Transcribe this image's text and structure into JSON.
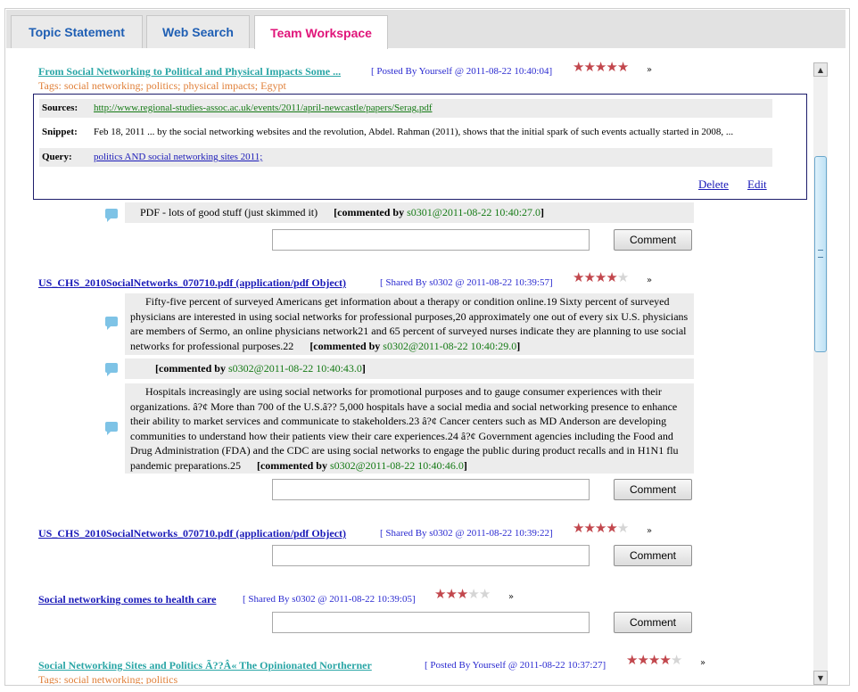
{
  "tabs": [
    {
      "label": "Topic Statement"
    },
    {
      "label": "Web Search"
    },
    {
      "label": "Team Workspace"
    }
  ],
  "items": [
    {
      "title": "From Social Networking to Political and Physical Impacts Some ...",
      "meta": "[ Posted By Yourself @ 2011-08-22 10:40:04]",
      "rating": 5,
      "tags": "Tags: social networking; politics; physical impacts; Egypt",
      "details": {
        "sources_label": "Sources:",
        "sources_value": "http://www.regional-studies-assoc.ac.uk/events/2011/april-newcastle/papers/Serag.pdf",
        "snippet_label": "Snippet:",
        "snippet_value": "Feb 18, 2011 ... by the social networking websites and the revolution, Abdel. Rahman (2011), shows that the initial spark of such events actually started in 2008, ...",
        "query_label": "Query:",
        "query_value": "politics AND social networking sites 2011;",
        "delete_label": "Delete",
        "edit_label": "Edit"
      },
      "comments": [
        {
          "text": "PDF - lots of good stuff (just skimmed it)",
          "by": "[commented by",
          "user": "s0301@2011-08-22 10:40:27.0",
          "end": "]"
        }
      ]
    },
    {
      "title": "US_CHS_2010SocialNetworks_070710.pdf (application/pdf Object)",
      "meta": "[ Shared By s0302 @ 2011-08-22 10:39:57]",
      "rating": 4,
      "comments": [
        {
          "text": "Fifty-five percent of surveyed Americans get information about a therapy or condition online.19 Sixty percent of surveyed physicians are interested in using social networks for professional purposes,20 approximately one out of every six U.S. physicians are members of Sermo, an online physicians network21 and 65 percent of surveyed nurses indicate they are planning to use social networks for professional purposes.22",
          "by": "[commented by",
          "user": "s0302@2011-08-22 10:40:29.0",
          "end": "]"
        },
        {
          "text": "",
          "by": "[commented by",
          "user": "s0302@2011-08-22 10:40:43.0",
          "end": "]"
        },
        {
          "text": "Hospitals increasingly are using social networks for promotional purposes and to gauge consumer experiences with their organizations. â?¢ More than 700 of the U.S.â?? 5,000 hospitals have a social media and social networking presence to enhance their ability to market services and communicate to stakeholders.23 â?¢ Cancer centers such as MD Anderson are developing communities to understand how their patients view their care experiences.24 â?¢ Government agencies including the Food and Drug Administration (FDA) and the CDC are using social networks to engage the public during product recalls and in H1N1 flu pandemic preparations.25",
          "by": "[commented by",
          "user": "s0302@2011-08-22 10:40:46.0",
          "end": "]"
        }
      ]
    },
    {
      "title": "US_CHS_2010SocialNetworks_070710.pdf (application/pdf Object)",
      "meta": "[ Shared By s0302 @ 2011-08-22 10:39:22]",
      "rating": 4
    },
    {
      "title": "Social networking comes to health care",
      "meta": "[ Shared By s0302 @ 2011-08-22 10:39:05]",
      "rating": 3
    },
    {
      "title": "Social Networking Sites and Politics Ã??Â« The Opinionated Northerner",
      "meta": "[ Posted By Yourself @ 2011-08-22 10:37:27]",
      "rating": 4,
      "tags": "Tags: social networking; politics"
    }
  ],
  "comment_button_label": "Comment",
  "expand_glyph": "»",
  "star_glyph": "★",
  "scroll_up_glyph": "▲",
  "scroll_down_glyph": "▼",
  "scroll_position_fraction": 0.2
}
